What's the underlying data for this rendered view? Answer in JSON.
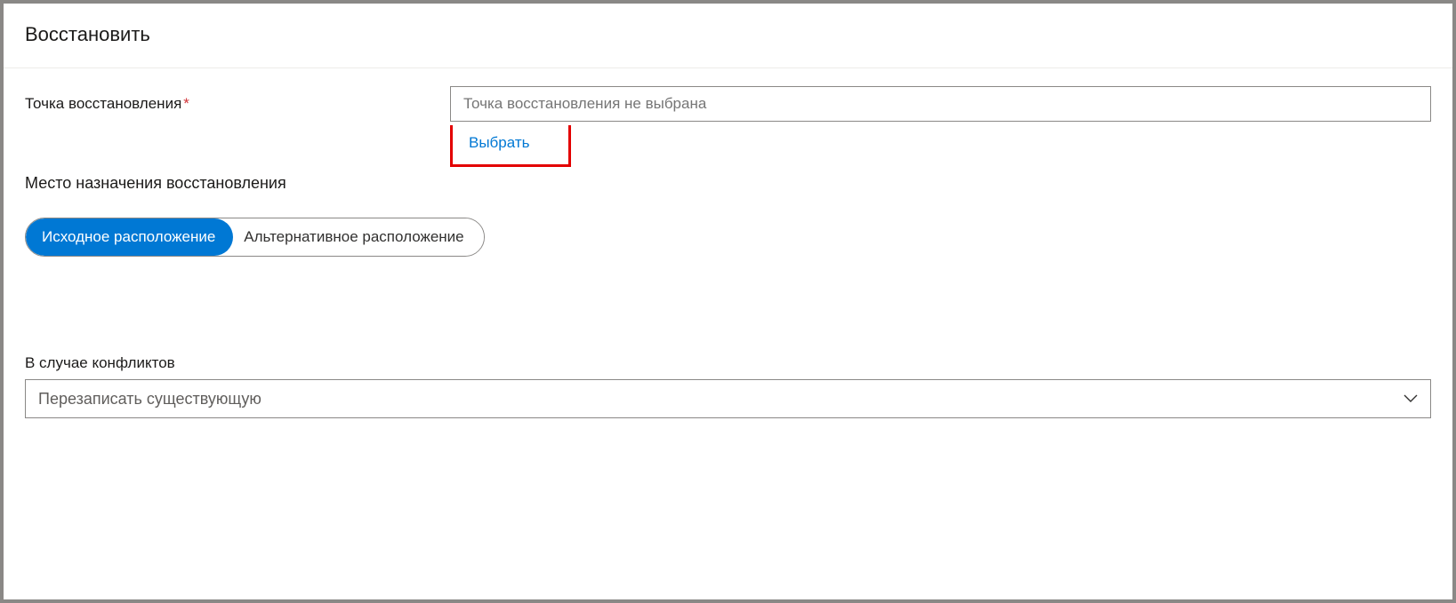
{
  "panel": {
    "title": "Восстановить"
  },
  "restore_point": {
    "label": "Точка восстановления",
    "required_mark": "*",
    "placeholder": "Точка восстановления не выбрана",
    "select_link": "Выбрать"
  },
  "destination": {
    "section_label": "Место назначения восстановления",
    "option_original": "Исходное расположение",
    "option_alternate": "Альтернативное расположение"
  },
  "conflict": {
    "label": "В случае конфликтов",
    "selected": "Перезаписать существующую"
  }
}
